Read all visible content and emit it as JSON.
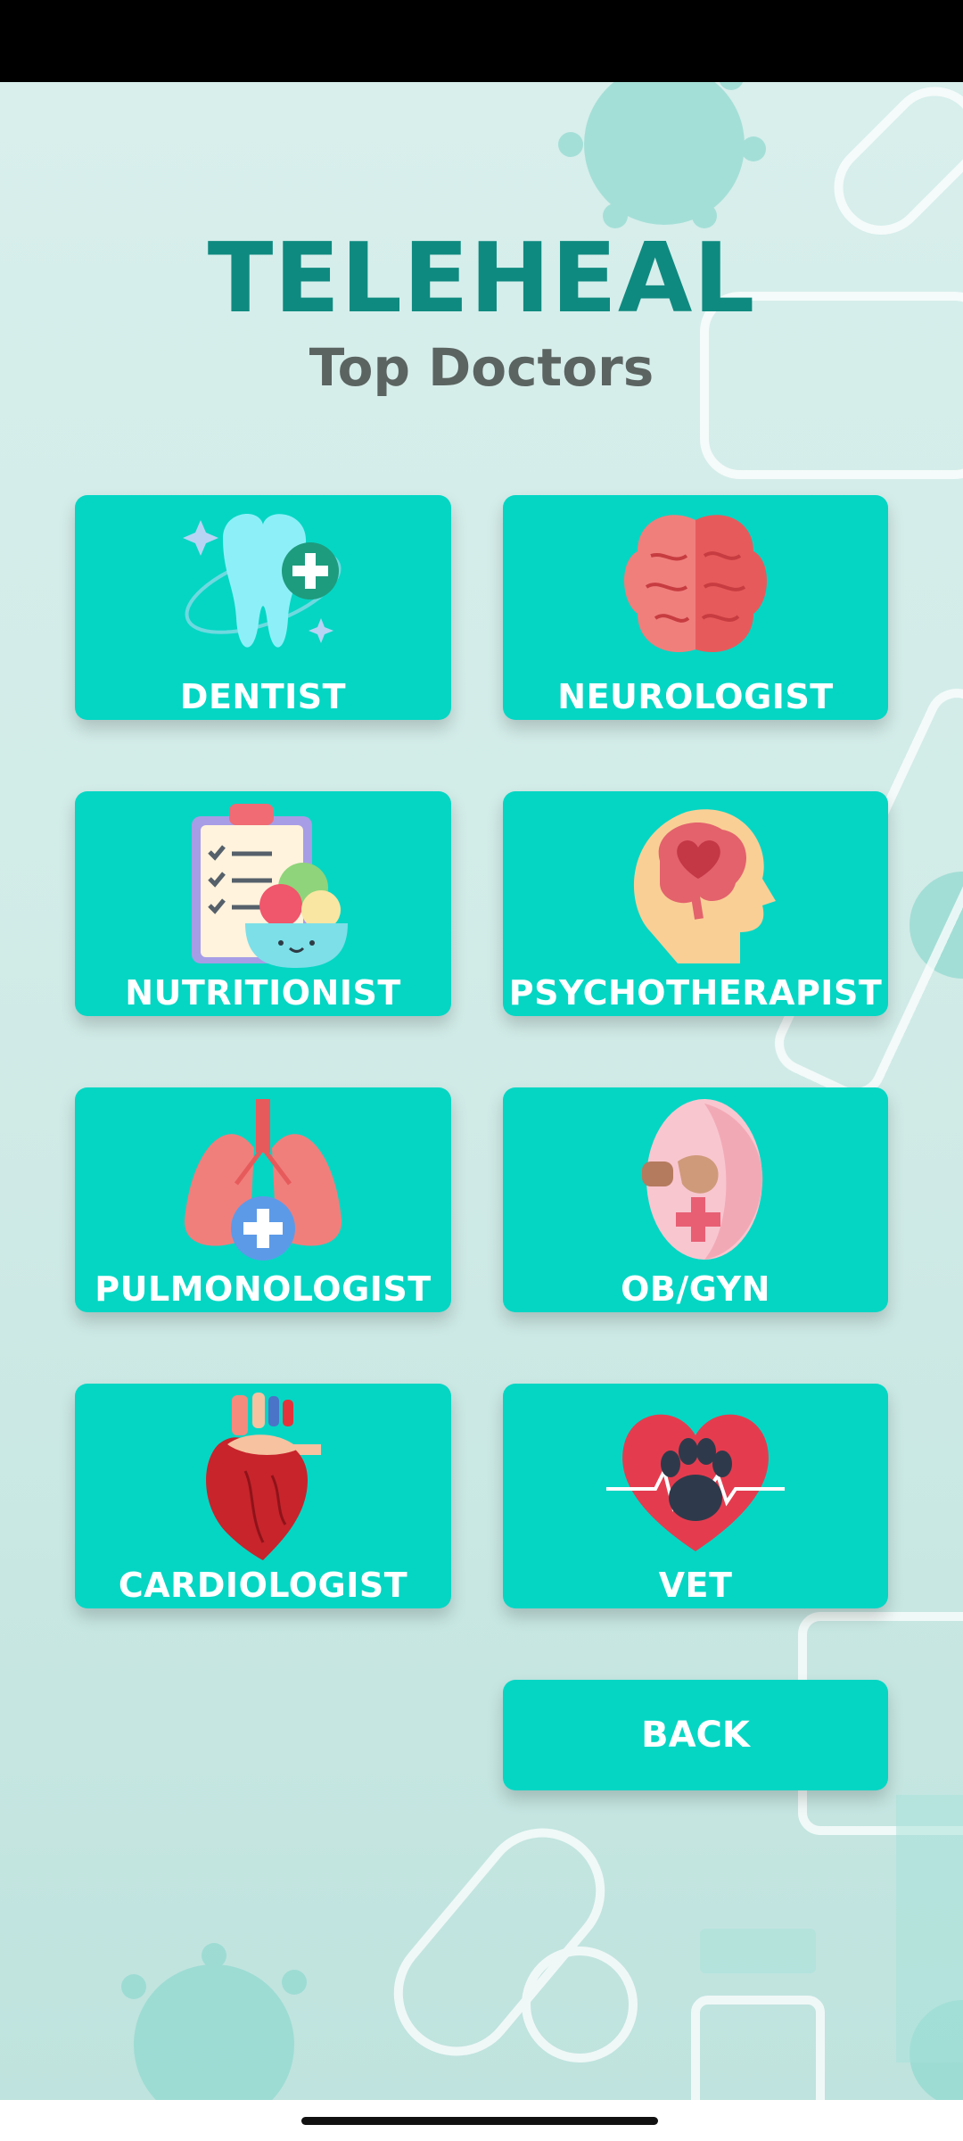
{
  "app": {
    "title": "TELEHEAL",
    "subtitle": "Top Doctors"
  },
  "specialties": [
    {
      "label": "DENTIST",
      "icon": "tooth-icon"
    },
    {
      "label": "NEUROLOGIST",
      "icon": "brain-icon"
    },
    {
      "label": "NUTRITIONIST",
      "icon": "clipboard-salad-icon"
    },
    {
      "label": "PSYCHOTHERAPIST",
      "icon": "head-heart-icon"
    },
    {
      "label": "PULMONOLOGIST",
      "icon": "lungs-icon"
    },
    {
      "label": "OB/GYN",
      "icon": "pregnancy-icon"
    },
    {
      "label": "CARDIOLOGIST",
      "icon": "heart-organ-icon"
    },
    {
      "label": "VET",
      "icon": "paw-heart-icon"
    }
  ],
  "back_button": {
    "label": "BACK"
  },
  "colors": {
    "card": "#05d6c4",
    "title": "#0f8a80",
    "subtitle": "#5b6461",
    "background": "#d8efec"
  }
}
